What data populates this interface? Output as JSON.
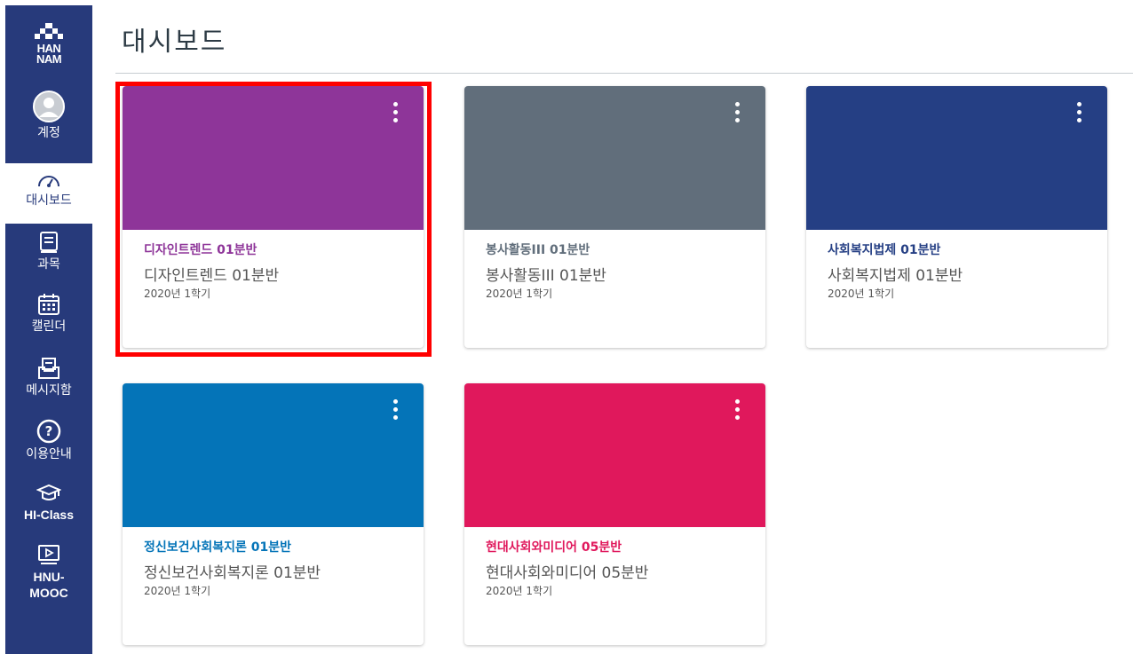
{
  "logo": {
    "line1": "HAN",
    "line2": "NAM"
  },
  "nav": [
    {
      "label": "계정",
      "icon": "account-avatar-icon"
    },
    {
      "label": "대시보드",
      "icon": "dashboard-gauge-icon",
      "active": true
    },
    {
      "label": "과목",
      "icon": "courses-book-icon"
    },
    {
      "label": "캘린더",
      "icon": "calendar-icon"
    },
    {
      "label": "메시지함",
      "icon": "inbox-icon"
    },
    {
      "label": "이용안내",
      "icon": "help-icon"
    },
    {
      "label": "HI-Class",
      "icon": "graduation-cap-icon"
    },
    {
      "label": "HNU-\nMOOC",
      "icon": "video-monitor-icon"
    }
  ],
  "page": {
    "title": "대시보드"
  },
  "cards": [
    {
      "title": "디자인트렌드 01분반",
      "subtitle": "디자인트렌드 01분반",
      "term": "2020년 1학기",
      "color": "#8e3599"
    },
    {
      "title": "봉사활동III 01분반",
      "subtitle": "봉사활동III 01분반",
      "term": "2020년 1학기",
      "color": "#616e7b"
    },
    {
      "title": "사회복지법제 01분반",
      "subtitle": "사회복지법제 01분반",
      "term": "2020년 1학기",
      "color": "#253f84"
    },
    {
      "title": "정신보건사회복지론 01분반",
      "subtitle": "정신보건사회복지론 01분반",
      "term": "2020년 1학기",
      "color": "#0474b8"
    },
    {
      "title": "현대사회와미디어 05분반",
      "subtitle": "현대사회와미디어 05분반",
      "term": "2020년 1학기",
      "color": "#e0185c"
    }
  ],
  "colors": {
    "sidebar": "#273a7b",
    "highlight": "#ff0000"
  }
}
